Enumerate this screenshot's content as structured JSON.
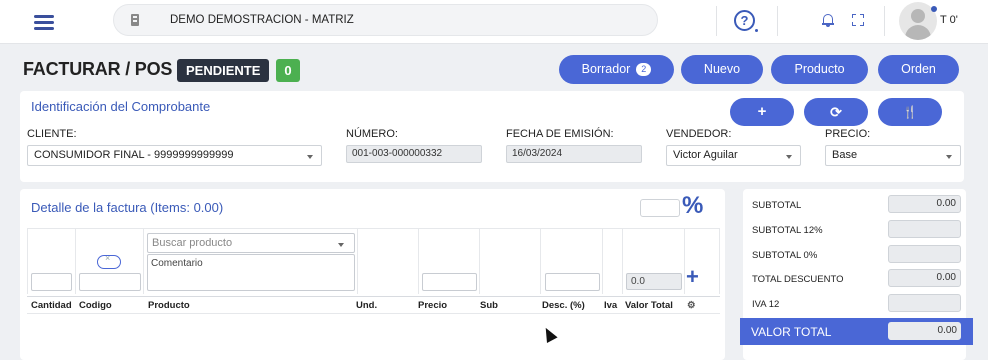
{
  "topbar": {
    "company": "DEMO DEMOSTRACION - MATRIZ",
    "help_symbol": "?",
    "user": "T 0'",
    "icons": [
      "menu-icon",
      "building-icon",
      "help-icon",
      "bell-icon",
      "fullscreen-icon",
      "avatar-icon"
    ]
  },
  "header": {
    "title": "FACTURAR / POS",
    "status": "PENDIENTE",
    "count": "0",
    "buttons": {
      "borrador": "Borrador",
      "borrador_count": "2",
      "nuevo": "Nuevo",
      "producto": "Producto",
      "orden": "Orden"
    }
  },
  "identificacion": {
    "title": "Identificación del Comprobante",
    "action_icons": {
      "add": "+",
      "refresh": "⟳",
      "restaurant": "🍴"
    },
    "cliente": {
      "label": "CLIENTE:",
      "value": "CONSUMIDOR FINAL - 9999999999999"
    },
    "numero": {
      "label": "NÚMERO:",
      "value": "001-003-000000332"
    },
    "fecha": {
      "label": "FECHA DE EMISIÓN:",
      "value": "16/03/2024"
    },
    "vendedor": {
      "label": "VENDEDOR:",
      "value": "Victor Aguilar"
    },
    "precio": {
      "label": "PRECIO:",
      "value": "Base"
    }
  },
  "detalle": {
    "title": "Detalle de la factura (Items: 0.00)",
    "percent_symbol": "%",
    "search_placeholder": "Buscar producto",
    "comment_placeholder": "Comentario",
    "valor_total_input": "0.0",
    "add_symbol": "+",
    "columns": [
      "Cantidad",
      "Codigo",
      "Producto",
      "Und.",
      "Precio",
      "Sub",
      "Desc. (%)",
      "Iva",
      "Valor Total"
    ],
    "settings_icon": "gears-icon"
  },
  "totales": {
    "rows": [
      {
        "label": "SUBTOTAL",
        "value": "0.00"
      },
      {
        "label": "SUBTOTAL 12%",
        "value": ""
      },
      {
        "label": "SUBTOTAL 0%",
        "value": ""
      },
      {
        "label": "TOTAL DESCUENTO",
        "value": "0.00"
      },
      {
        "label": "IVA 12",
        "value": ""
      }
    ],
    "grand_label": "VALOR TOTAL",
    "grand_value": "0.00"
  },
  "colors": {
    "primary": "#4a67d6",
    "accent_text": "#3a5ab8",
    "status_dark": "#2b3240",
    "count_green": "#4cb050"
  }
}
